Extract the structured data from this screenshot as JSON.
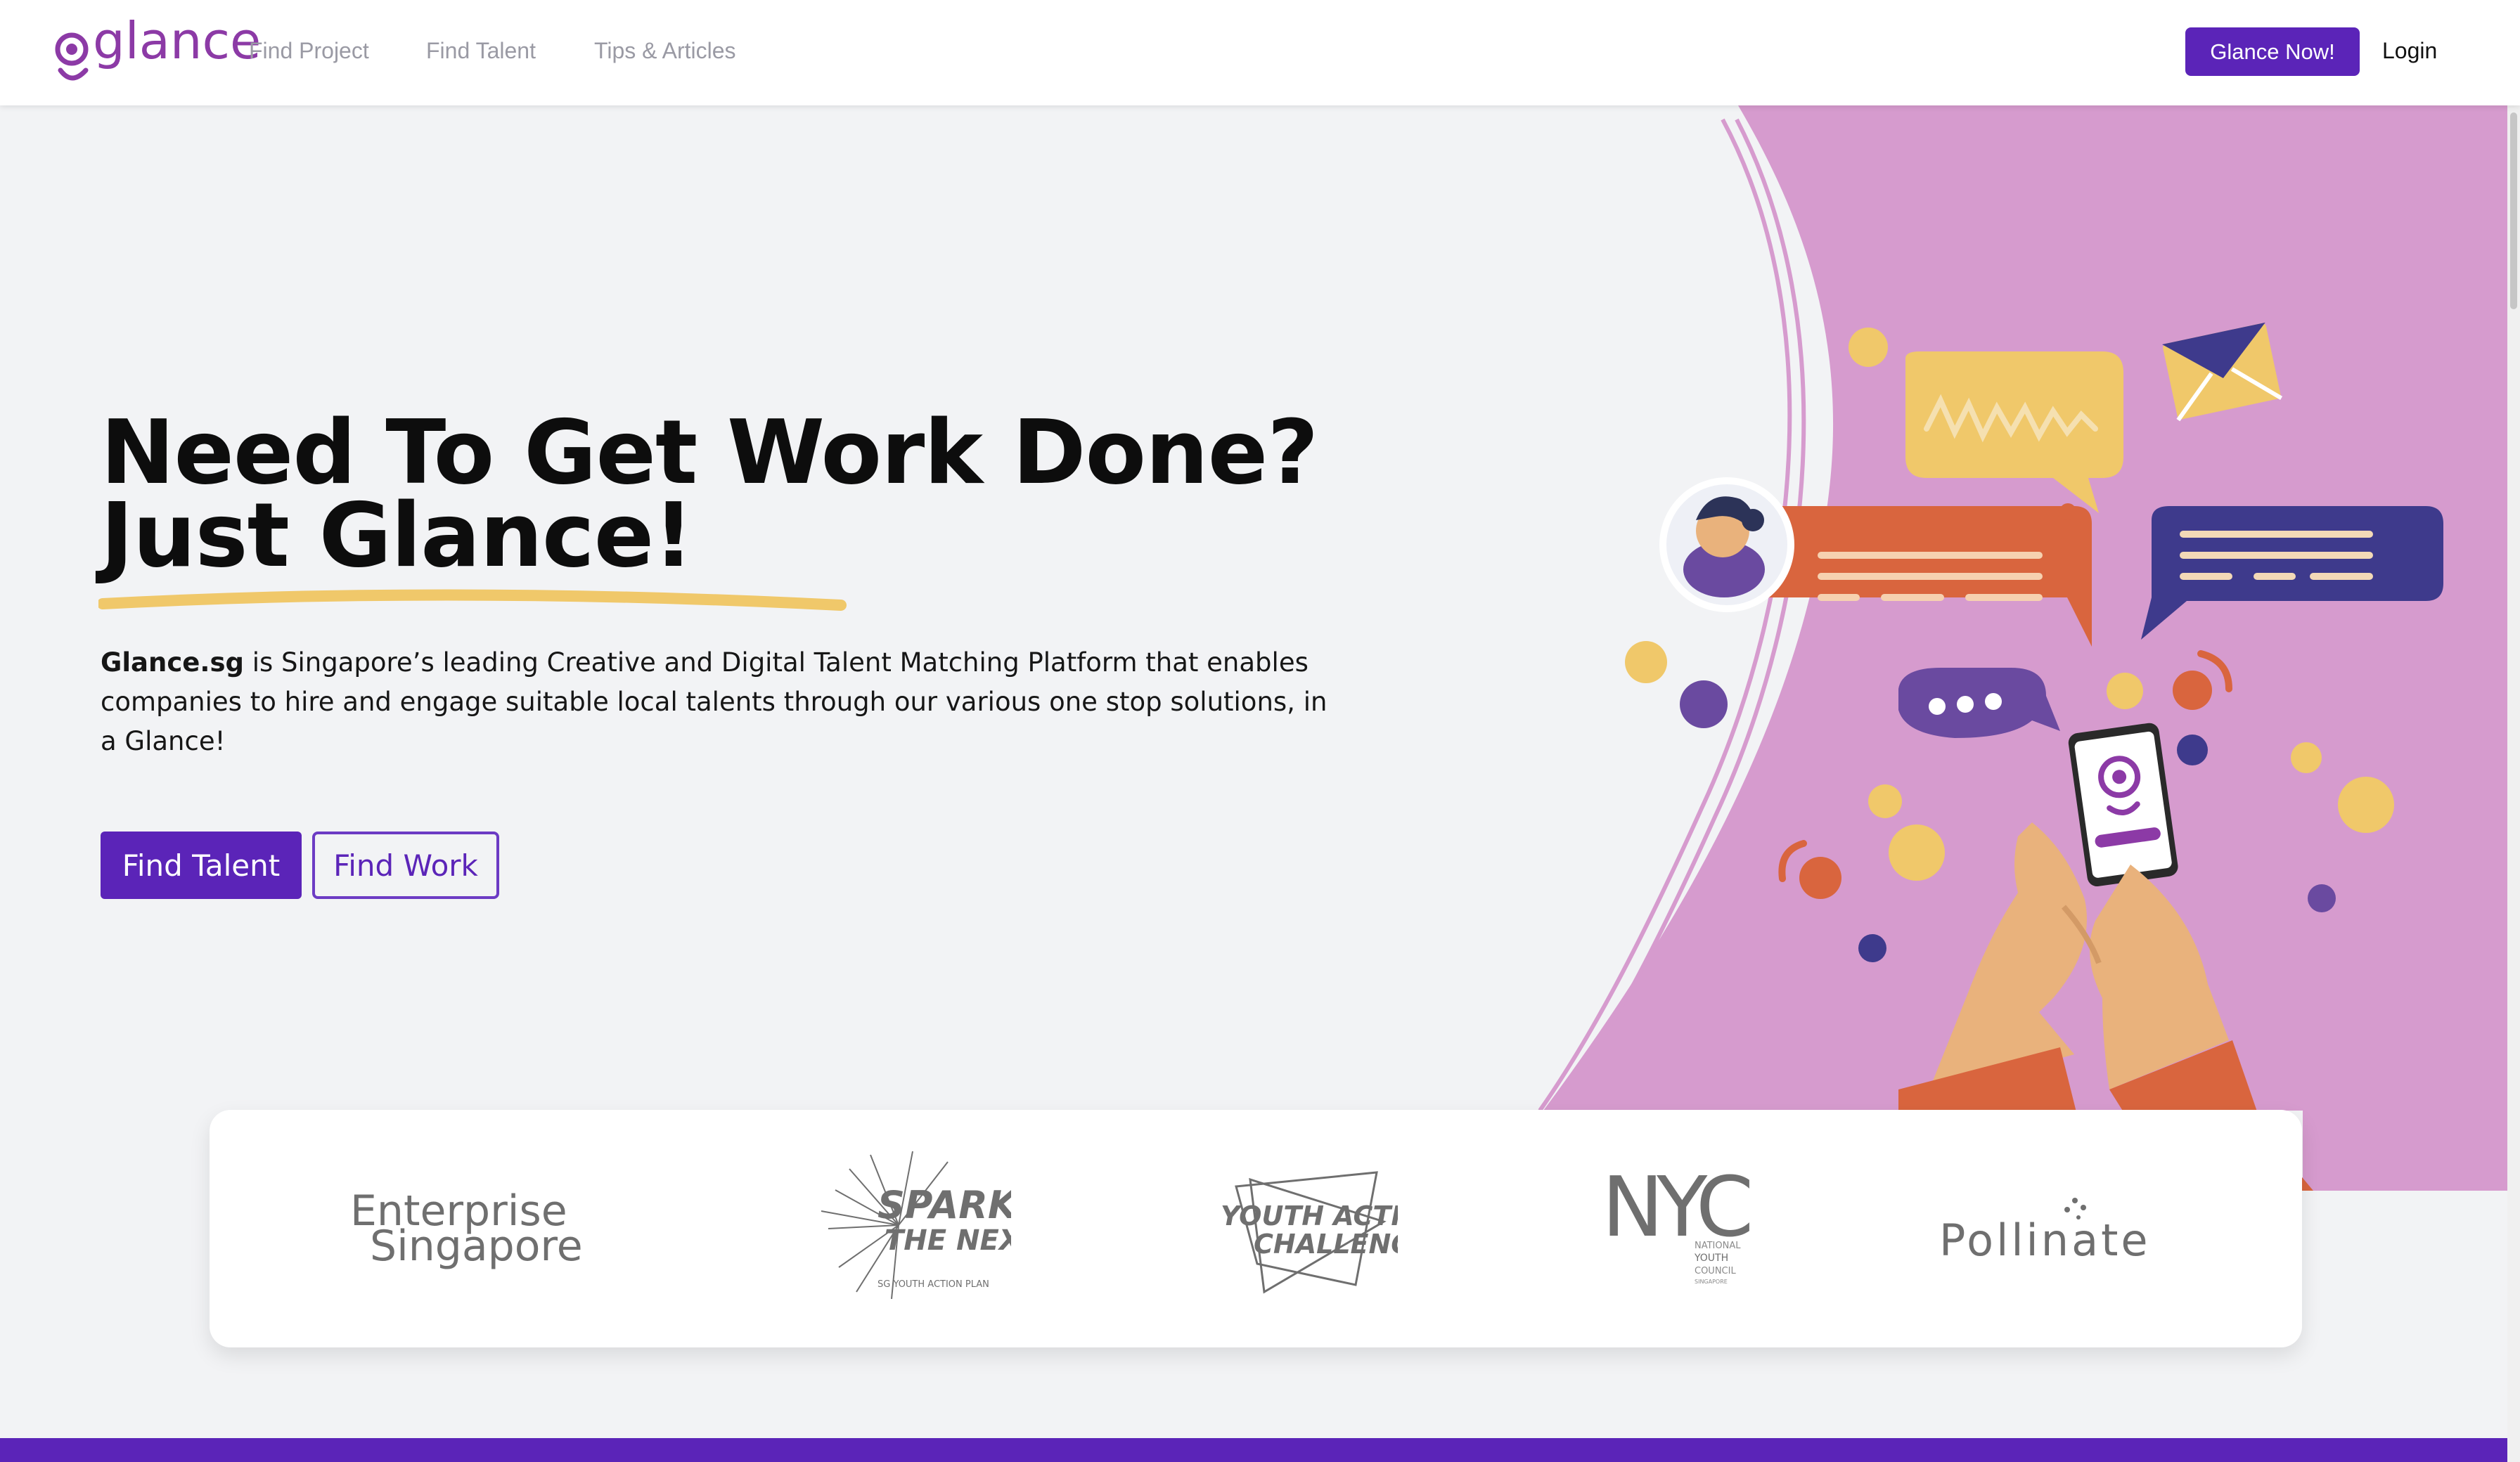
{
  "nav": {
    "logo": "glance",
    "links": [
      "Find Project",
      "Find Talent",
      "Tips & Articles"
    ],
    "cta": "Glance Now!",
    "login": "Login"
  },
  "hero": {
    "headline_line1": "Need To Get Work Done?",
    "headline_line2": "Just Glance!",
    "intro_brand": "Glance.sg",
    "intro_text": " is Singapore’s leading Creative and Digital Talent Matching Platform that enables companies to hire and engage suitable local talents through our various one stop solutions, in a Glance!",
    "button_primary": "Find Talent",
    "button_secondary": "Find Work"
  },
  "partners": {
    "enterprise_line1": "Enterprise",
    "enterprise_line2": "Singapore",
    "spark_line1": "SPARK",
    "spark_line2": "THE NEXT",
    "spark_sub": "SG YOUTH ACTION PLAN",
    "yac_line1": "YOUTH ACTION",
    "yac_line2": "CHALLENGE",
    "nyc_mark": "NYC",
    "nyc_sub1": "NATIONAL",
    "nyc_sub2": "YOUTH",
    "nyc_sub3": "COUNCIL",
    "nyc_sub4": "SINGAPORE",
    "pollinate": "Pollinate"
  },
  "colors": {
    "brand_purple": "#5b24b8",
    "logo_purple": "#8c3aa6",
    "hero_pink": "#d69bce",
    "accent_yellow": "#f0c86a",
    "bubble_orange": "#d9653e",
    "bubble_indigo": "#3e3a8c"
  }
}
